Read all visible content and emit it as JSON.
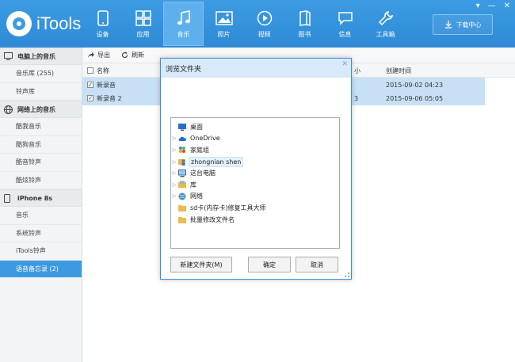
{
  "app": {
    "name": "iTools",
    "colors": {
      "header": "#3c9be3",
      "active_nav": "#5eb0ec",
      "selection": "#c7e0f5",
      "active_side": "#3d9ae2"
    }
  },
  "nav": [
    {
      "label": "设备",
      "icon": "device-icon"
    },
    {
      "label": "应用",
      "icon": "apps-icon"
    },
    {
      "label": "音乐",
      "icon": "music-note-icon",
      "active": true
    },
    {
      "label": "照片",
      "icon": "photo-icon"
    },
    {
      "label": "视频",
      "icon": "video-play-icon"
    },
    {
      "label": "图书",
      "icon": "book-icon"
    },
    {
      "label": "信息",
      "icon": "message-icon"
    },
    {
      "label": "工具箱",
      "icon": "wrench-icon"
    }
  ],
  "download": {
    "label": "下载中心"
  },
  "window_controls": [
    "▾",
    "—",
    "✕"
  ],
  "sidebar": {
    "sections": [
      {
        "title": "电脑上的音乐",
        "items": [
          "音乐库 (255)",
          "铃声库"
        ]
      },
      {
        "title": "网络上的音乐",
        "items": [
          "酷我音乐",
          "酷狗音乐",
          "酷音铃声",
          "酷炫铃声"
        ]
      },
      {
        "title": "iPhone 8s",
        "items": [
          "音乐",
          "系统铃声",
          "iTools铃声",
          "语音备忘录 (2)"
        ]
      }
    ]
  },
  "toolbar": {
    "export": "导出",
    "refresh": "刷新"
  },
  "table": {
    "headers": {
      "name": "名称",
      "size": "小",
      "created": "创建时间"
    },
    "rows": [
      {
        "name": "新录音",
        "size": "",
        "created": "2015-09-02 04:23"
      },
      {
        "name": "新录音 2",
        "size": "3",
        "created": "2015-09-06 05:05"
      }
    ]
  },
  "dialog": {
    "title": "浏览文件夹",
    "close": "✕",
    "tree": [
      {
        "label": "桌面",
        "icon": "desktop-icon",
        "arrow": ""
      },
      {
        "label": "OneDrive",
        "icon": "cloud-icon",
        "arrow": "▷"
      },
      {
        "label": "家庭组",
        "icon": "homegroup-icon",
        "arrow": "▷"
      },
      {
        "label": "zhongnian shen",
        "icon": "user-folder-icon",
        "arrow": "▷",
        "selected": true
      },
      {
        "label": "这台电脑",
        "icon": "computer-icon",
        "arrow": "▷"
      },
      {
        "label": "库",
        "icon": "library-icon",
        "arrow": "▷"
      },
      {
        "label": "网络",
        "icon": "network-icon",
        "arrow": "▷"
      },
      {
        "label": "sd卡(内存卡)修复工具大师",
        "icon": "folder-icon",
        "arrow": ""
      },
      {
        "label": "批量修改文件名",
        "icon": "folder-icon",
        "arrow": ""
      }
    ],
    "buttons": {
      "new_folder": "新建文件夹(M)",
      "ok": "确定",
      "cancel": "取消"
    }
  }
}
